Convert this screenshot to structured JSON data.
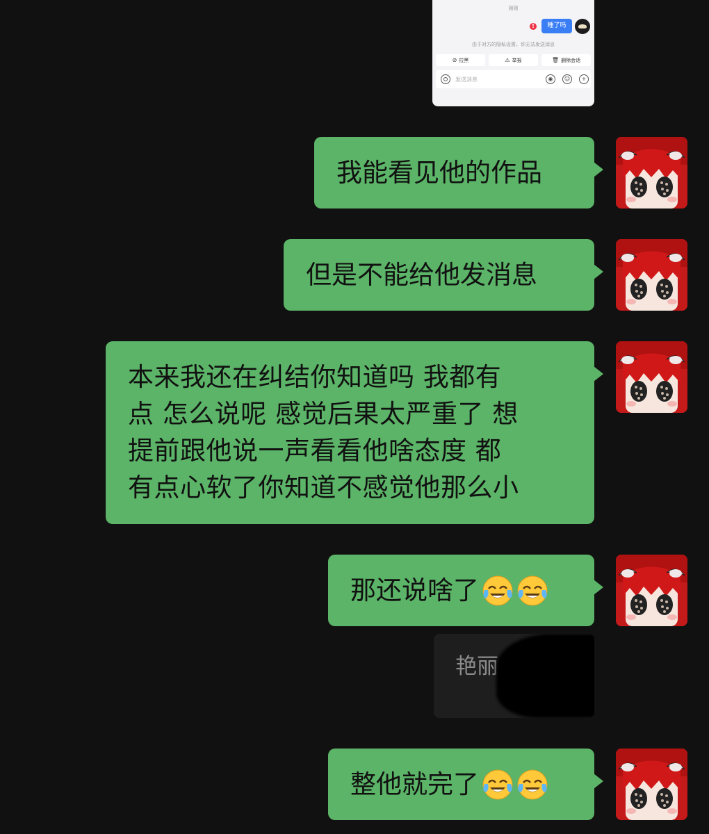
{
  "embedded_screenshot": {
    "time_label": "刚刚",
    "sent_message": "睡了吗",
    "error_mark": "!",
    "privacy_notice": "由于对方的隐私设置，你无法发送消息",
    "actions": [
      {
        "icon": "block-icon",
        "glyph": "⊘",
        "label": "拉黑"
      },
      {
        "icon": "warning-icon",
        "glyph": "⚠",
        "label": "举报"
      },
      {
        "icon": "trash-icon",
        "glyph": "🗑",
        "label": "删除会话"
      }
    ],
    "input_placeholder": "发送消息",
    "input_controls": [
      {
        "icon": "voice-icon",
        "glyph": "◉"
      },
      {
        "icon": "emoji-icon",
        "glyph": "☺"
      },
      {
        "icon": "plus-icon",
        "glyph": "+"
      }
    ]
  },
  "messages": [
    {
      "id": "m1",
      "text": "我能看见他的作品"
    },
    {
      "id": "m2",
      "text": "但是不能给他发消息"
    },
    {
      "id": "m3",
      "lines": [
        "本来我还在纠结你知道吗 我都有",
        "点 怎么说呢 感觉后果太严重了 想",
        "提前跟他说一声看看他啥态度 都",
        "有点心软了你知道不感觉他那么小"
      ]
    },
    {
      "id": "m4",
      "text": "那还说啥了",
      "emoji": "face-with-tears-of-joy"
    },
    {
      "id": "m5",
      "text": "整他就完了",
      "emoji": "face-with-tears-of-joy"
    }
  ],
  "other_message": {
    "sender_name": "艳丽："
  },
  "colors": {
    "background": "#111111",
    "bubble_green": "#5bb467",
    "avatar_red": "#c51a1a",
    "link_blue": "#3a7ef6"
  }
}
